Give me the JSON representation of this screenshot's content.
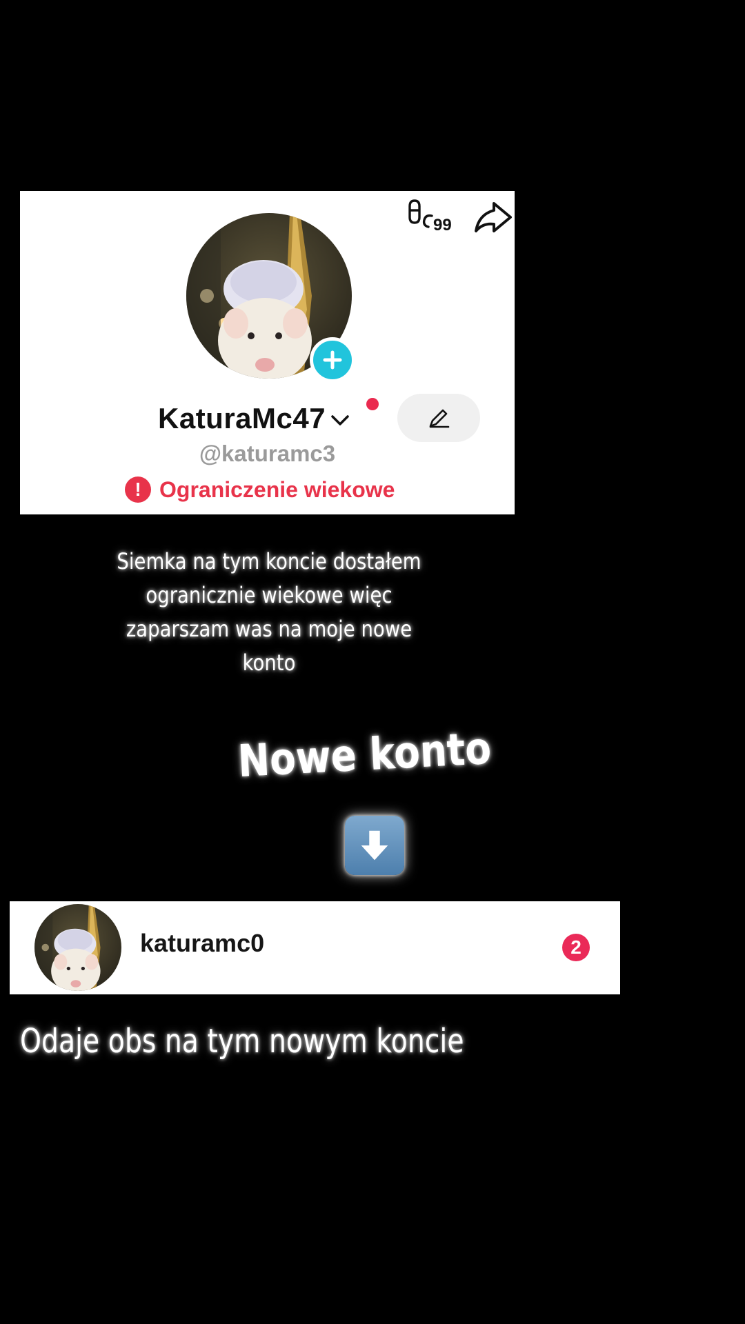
{
  "old_profile": {
    "display_name": "KaturaMc47",
    "username": "@katuramc3",
    "age_restriction": "Ograniczenie wiekowe",
    "top_icons": [
      "views-icon",
      "share-icon"
    ],
    "edit_icon": "pencil-icon",
    "follow_icon": "plus-icon",
    "alert_symbol": "!",
    "colors": {
      "alert": "#e8334a",
      "follow": "#21c4dc",
      "dot": "#ea2a4f"
    }
  },
  "captions": {
    "intro": "Siemka na tym koncie dostałem ogranicznie wiekowe więc zaparszam was na moje nowe konto",
    "new_account_label": "Nowe konto",
    "footer": "Odaje obs na tym nowym koncie"
  },
  "new_account": {
    "username": "katuramc0",
    "badge_count": "2",
    "badge_color": "#ea2a58"
  },
  "emoji": {
    "arrow": "down-arrow-icon"
  }
}
